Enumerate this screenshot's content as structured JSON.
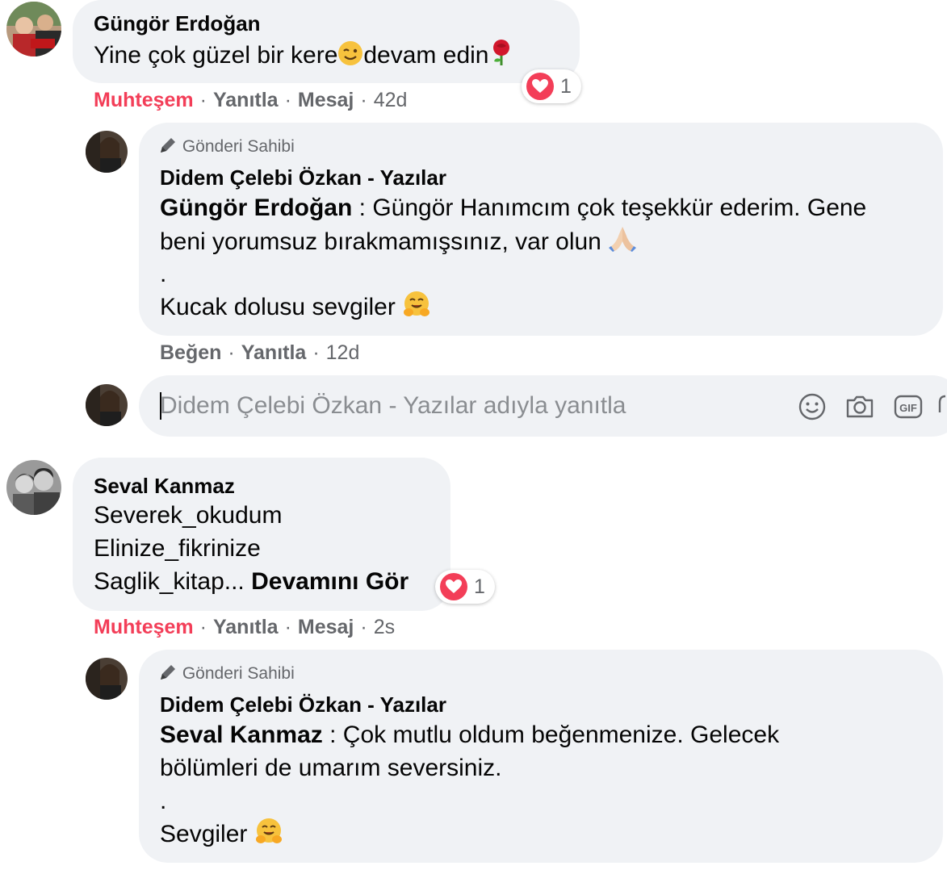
{
  "comments": [
    {
      "author": "Güngör Erdoğan",
      "text_before": "Yine çok güzel bir kere",
      "text_after": "devam edin",
      "reaction_count": "1",
      "actions": {
        "react": "Muhteşem",
        "reply": "Yanıtla",
        "message": "Mesaj",
        "time": "42d"
      },
      "reply": {
        "badge": "Gönderi Sahibi",
        "author": "Didem Çelebi Özkan - Yazılar",
        "mention": "Güngör Erdoğan",
        "line1": " : Güngör Hanımcım çok teşekkür ederim. Gene",
        "line2": "beni yorumsuz bırakmamışsınız, var olun",
        "line3": ".",
        "line4": "Kucak dolusu sevgiler",
        "actions": {
          "like": "Beğen",
          "reply": "Yanıtla",
          "time": "12d"
        }
      }
    },
    {
      "author": "Seval Kanmaz",
      "line1": "Severek_okudum",
      "line2": "Elinize_fikrinize",
      "line3": "Saglik_kitap...",
      "see_more": "Devamını Gör",
      "reaction_count": "1",
      "actions": {
        "react": "Muhteşem",
        "reply": "Yanıtla",
        "message": "Mesaj",
        "time": "2s"
      },
      "reply": {
        "badge": "Gönderi Sahibi",
        "author": "Didem Çelebi Özkan - Yazılar",
        "mention": "Seval Kanmaz",
        "line1": " : Çok mutlu oldum beğenmenize. Gelecek",
        "line2": "bölümleri de umarım seversiniz.",
        "line3": ".",
        "line4": "Sevgiler"
      }
    }
  ],
  "reply_input": {
    "placeholder": "Didem Çelebi Özkan - Yazılar adıyla yanıtla",
    "icons": [
      "emoji-icon",
      "camera-icon",
      "gif-icon",
      "sticker-icon"
    ]
  },
  "colors": {
    "bubble": "#f0f2f5",
    "reaction_text": "#f33e58",
    "meta_text": "#65676b",
    "heart": "#f33e58"
  }
}
